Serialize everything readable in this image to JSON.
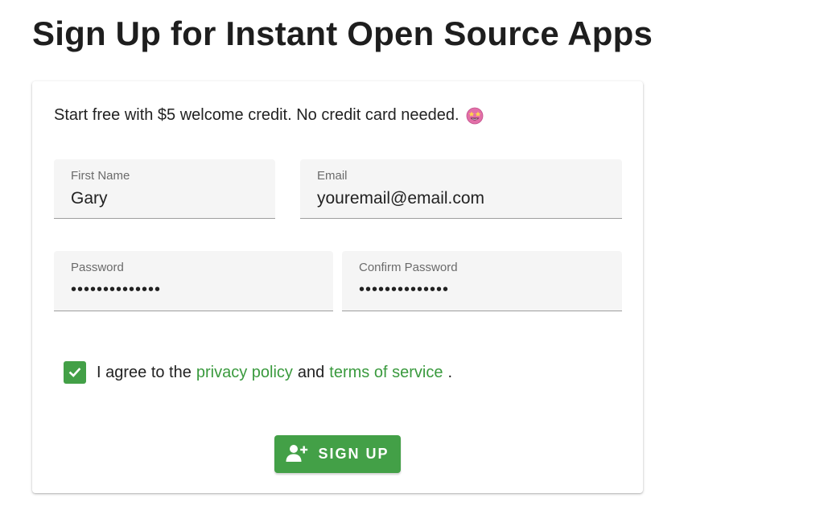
{
  "page": {
    "title": "Sign Up for Instant Open Source Apps"
  },
  "form": {
    "intro_text": "Start free with $5 welcome credit. No credit card needed.",
    "intro_emoji_icon": "star-struck-emoji-icon",
    "first_name": {
      "label": "First Name",
      "value": "Gary"
    },
    "email": {
      "label": "Email",
      "value": "youremail@email.com"
    },
    "password": {
      "label": "Password",
      "value": "••••••••••••••"
    },
    "confirm_password": {
      "label": "Confirm Password",
      "value": "••••••••••••••"
    },
    "agreement": {
      "checked": true,
      "prefix": "I agree to the",
      "privacy_link": "privacy policy",
      "middle": "and",
      "terms_link": "terms of service",
      "suffix": "."
    },
    "signup_button": {
      "label": "SIGN UP",
      "icon": "person-add-icon"
    }
  },
  "colors": {
    "accent_green": "#43a047",
    "link_green": "#3a9a3e",
    "field_background": "#f5f5f5"
  }
}
